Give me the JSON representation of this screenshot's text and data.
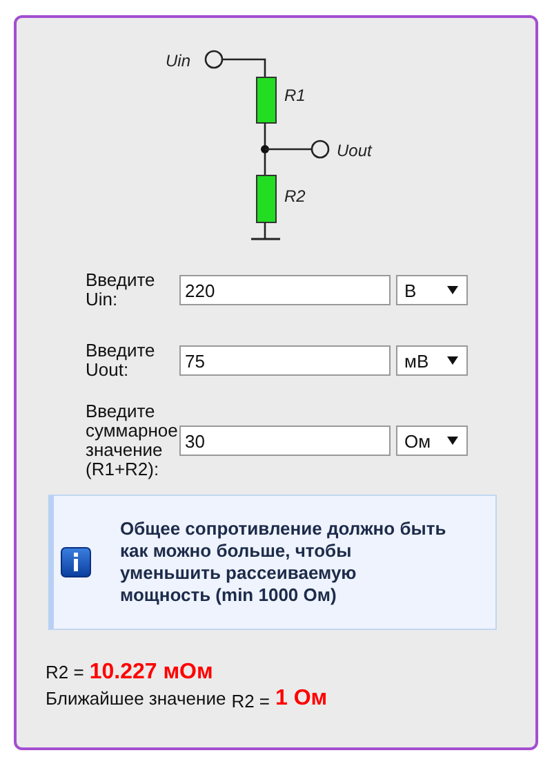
{
  "circuit": {
    "input_label": "Uin",
    "r1_label": "R1",
    "output_label": "Uout",
    "r2_label": "R2"
  },
  "fields": [
    {
      "label": "Введите Uin:",
      "value": "220",
      "unit": "В"
    },
    {
      "label": "Введите Uout:",
      "value": "75",
      "unit": "мВ"
    },
    {
      "label": "Введите суммарное значение (R1+R2):",
      "value": "30",
      "unit": "Ом"
    }
  ],
  "info": {
    "text": "Общее сопротивление должно быть как можно больше, чтобы уменьшить рассеиваемую мощность (min 1000 Ом)"
  },
  "result": {
    "prefix": "R2 =",
    "value": "10.227 мОм"
  },
  "nearest": {
    "label": "Ближайшее значение",
    "prefix": "R2 =",
    "value": "1 Ом"
  }
}
